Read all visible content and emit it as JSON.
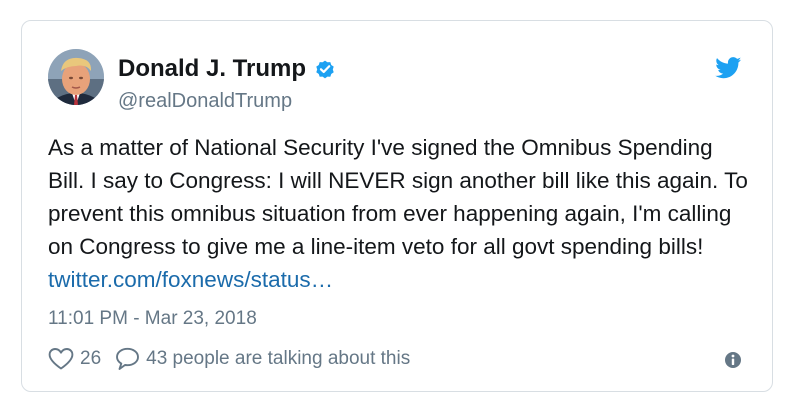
{
  "tweet": {
    "author": {
      "display_name": "Donald J. Trump",
      "handle": "@realDonaldTrump",
      "verified": true,
      "avatar_icon": "profile-photo"
    },
    "text": "As a matter of National Security I've signed the Omnibus Spending Bill. I say to Congress: I will NEVER sign another bill like this again. To prevent this omnibus situation from ever happening again, I'm calling on Congress to give me a line-item veto for all govt spending bills!",
    "link_text": "twitter.com/foxnews/status…",
    "timestamp": "11:01 PM - Mar 23, 2018",
    "likes_count": "26",
    "talking_text": "43 people are talking about this"
  },
  "icons": {
    "brand": "twitter-bird-icon",
    "verified": "verified-badge-icon",
    "like": "heart-icon",
    "reply": "speech-bubble-icon",
    "info": "info-icon"
  },
  "colors": {
    "brand": "#1da1f2",
    "link": "#1b6bab",
    "text": "#14171a",
    "secondary_text": "#657786",
    "border": "#d8dee3"
  }
}
